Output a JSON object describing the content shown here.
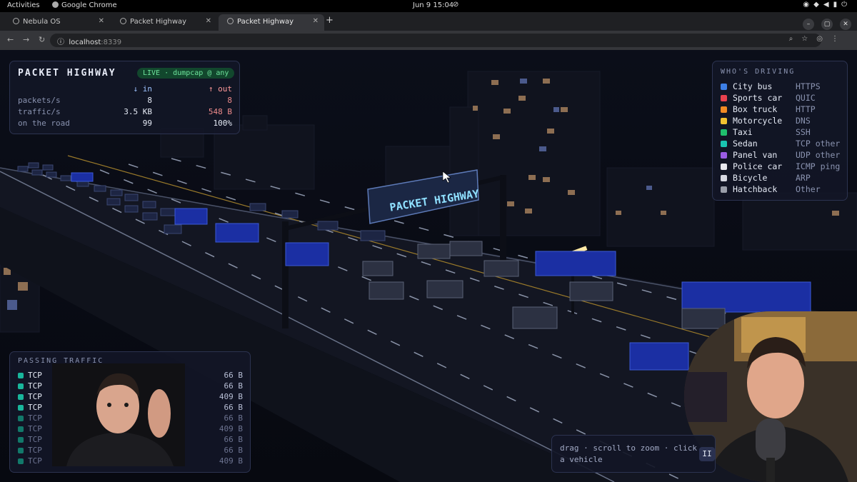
{
  "os_bar": {
    "activities": "Activities",
    "app_name": "Google Chrome",
    "clock": "Jun 9  15:04"
  },
  "browser": {
    "tabs": [
      {
        "label": "Nebula OS",
        "active": false
      },
      {
        "label": "Packet Highway",
        "active": false
      },
      {
        "label": "Packet Highway",
        "active": true
      }
    ],
    "url_host": "localhost",
    "url_port": ":8339"
  },
  "scene": {
    "sign_text": "PACKET HIGHWAY"
  },
  "stats": {
    "title": "PACKET HIGHWAY",
    "live_badge": "LIVE · dumpcap @ any",
    "col_in": "↓ in",
    "col_out": "↑ out",
    "rows": [
      {
        "label": "packets/s",
        "in": "8",
        "out": "8"
      },
      {
        "label": "traffic/s",
        "in": "3.5 KB",
        "out": "548 B"
      },
      {
        "label": "on the road",
        "in": "99",
        "out": "100%"
      }
    ]
  },
  "legend": {
    "title": "WHO'S DRIVING",
    "items": [
      {
        "vehicle": "City bus",
        "protocol": "HTTPS",
        "color": "#3d7fe6"
      },
      {
        "vehicle": "Sports car",
        "protocol": "QUIC",
        "color": "#e8414e"
      },
      {
        "vehicle": "Box truck",
        "protocol": "HTTP",
        "color": "#f08a24"
      },
      {
        "vehicle": "Motorcycle",
        "protocol": "DNS",
        "color": "#f2c230"
      },
      {
        "vehicle": "Taxi",
        "protocol": "SSH",
        "color": "#1fbf6d"
      },
      {
        "vehicle": "Sedan",
        "protocol": "TCP other",
        "color": "#19c4b1"
      },
      {
        "vehicle": "Panel van",
        "protocol": "UDP other",
        "color": "#9b5de5"
      },
      {
        "vehicle": "Police car",
        "protocol": "ICMP ping",
        "color": "#e8e8ee"
      },
      {
        "vehicle": "Bicycle",
        "protocol": "ARP",
        "color": "#d7d9e2"
      },
      {
        "vehicle": "Hatchback",
        "protocol": "Other",
        "color": "#9a9ea9"
      }
    ]
  },
  "traffic": {
    "title": "PASSING TRAFFIC",
    "packets": [
      {
        "protocol": "TCP",
        "size": "66 B",
        "dim": false
      },
      {
        "protocol": "TCP",
        "size": "66 B",
        "dim": false
      },
      {
        "protocol": "TCP",
        "size": "409 B",
        "dim": false
      },
      {
        "protocol": "TCP",
        "size": "66 B",
        "dim": false
      },
      {
        "protocol": "TCP",
        "size": "66 B",
        "dim": true
      },
      {
        "protocol": "TCP",
        "size": "409 B",
        "dim": true
      },
      {
        "protocol": "TCP",
        "size": "66 B",
        "dim": true
      },
      {
        "protocol": "TCP",
        "size": "66 B",
        "dim": true
      },
      {
        "protocol": "TCP",
        "size": "409 B",
        "dim": true
      }
    ]
  },
  "hint": {
    "text": "drag · scroll to zoom · click a vehicle",
    "button_label": "II"
  }
}
